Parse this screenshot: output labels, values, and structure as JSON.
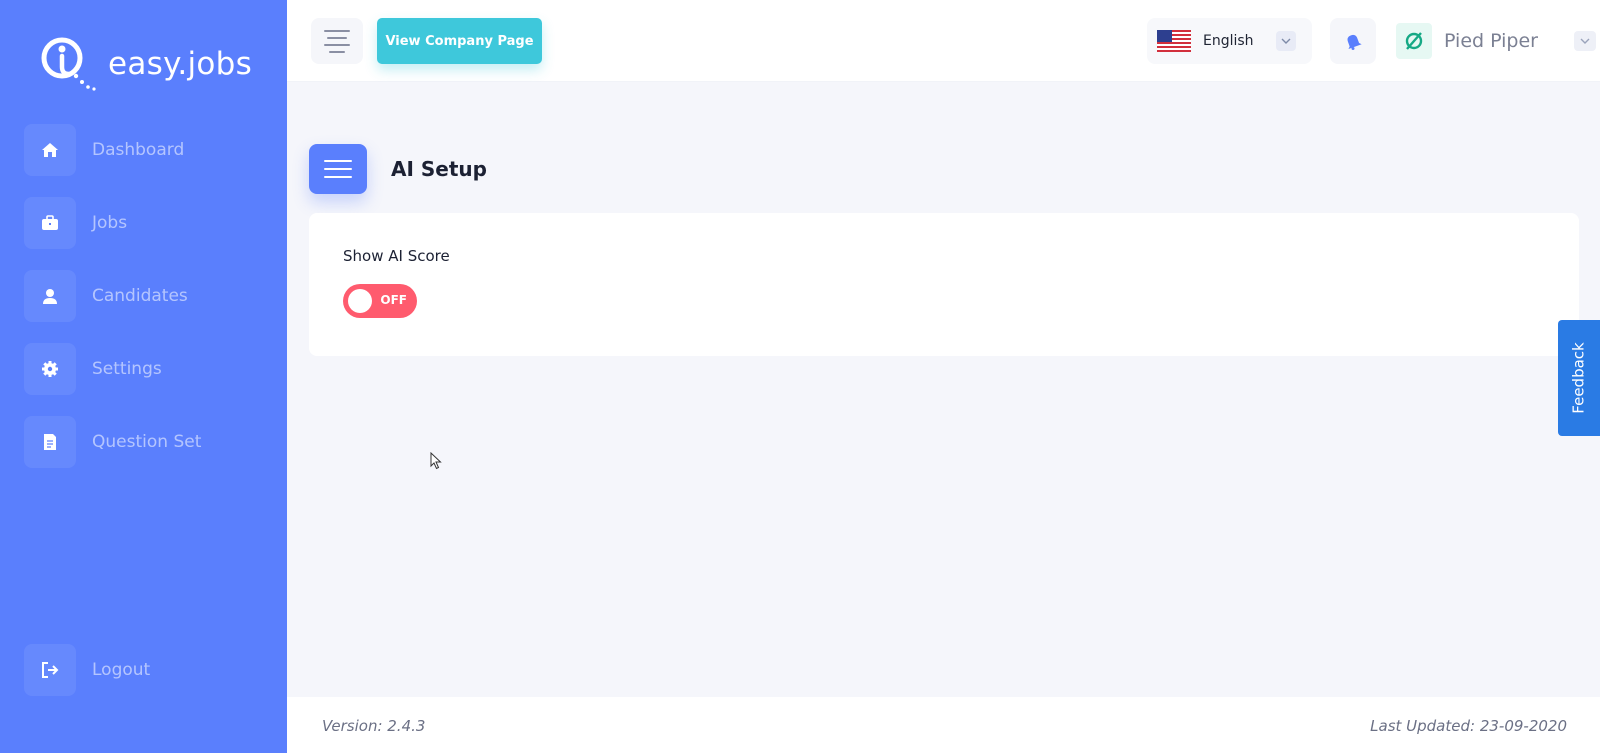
{
  "brand": {
    "name": "easy.jobs"
  },
  "sidebar": {
    "items": [
      {
        "label": "Dashboard",
        "icon": "home-icon"
      },
      {
        "label": "Jobs",
        "icon": "briefcase-icon"
      },
      {
        "label": "Candidates",
        "icon": "user-icon"
      },
      {
        "label": "Settings",
        "icon": "gear-icon"
      },
      {
        "label": "Question Set",
        "icon": "document-icon"
      }
    ],
    "logout": {
      "label": "Logout",
      "icon": "logout-icon"
    }
  },
  "header": {
    "view_company_label": "View Company Page",
    "language": {
      "selected": "English",
      "flag": "us-flag-icon"
    },
    "company": {
      "name": "Pied Piper"
    }
  },
  "main": {
    "page_title": "AI Setup",
    "setting": {
      "label": "Show AI Score",
      "toggle_state": "OFF"
    }
  },
  "feedback": {
    "label": "Feedback"
  },
  "footer": {
    "version": "Version: 2.4.3",
    "last_updated": "Last Updated: 23-09-2020"
  },
  "colors": {
    "sidebar": "#5a7ffd",
    "accent": "#3ec8db",
    "toggle_off": "#ff5b6e",
    "feedback": "#2a7be4"
  }
}
